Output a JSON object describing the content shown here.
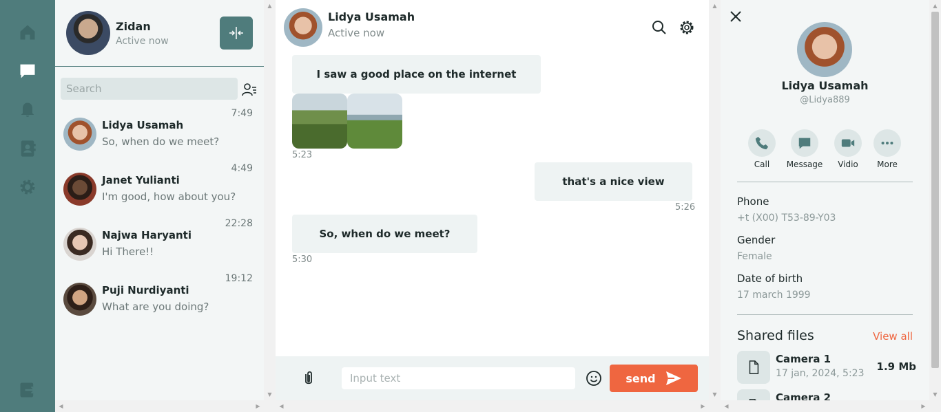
{
  "me": {
    "name": "Zidan",
    "status": "Active now"
  },
  "search": {
    "placeholder": "Search"
  },
  "chats": [
    {
      "name": "Lidya Usamah",
      "message": "So, when do we meet?",
      "time": "7:49"
    },
    {
      "name": "Janet Yulianti",
      "message": "I'm good, how about you?",
      "time": "4:49"
    },
    {
      "name": "Najwa Haryanti",
      "message": "Hi There!!",
      "time": "22:28"
    },
    {
      "name": "Puji Nurdiyanti",
      "message": "What are you doing?",
      "time": "19:12"
    }
  ],
  "conversation": {
    "peer_name": "Lidya Usamah",
    "peer_status": "Active now",
    "messages": [
      {
        "text": "I saw a good place on the internet",
        "time": "5:23",
        "side": "left"
      },
      {
        "text": "that's a nice view",
        "time": "5:26",
        "side": "right"
      },
      {
        "text": "So, when do we meet?",
        "time": "5:30",
        "side": "left"
      }
    ]
  },
  "composer": {
    "placeholder": "Input text",
    "send_label": "send"
  },
  "profile": {
    "name": "Lidya Usamah",
    "handle": "@Lidya889",
    "actions": [
      "Call",
      "Message",
      "Vidio",
      "More"
    ],
    "phone_label": "Phone",
    "phone": "+t (X00) T53-89-Y03",
    "gender_label": "Gender",
    "gender": "Female",
    "dob_label": "Date of birth",
    "dob": "17 march 1999",
    "shared_title": "Shared files",
    "view_all": "View all",
    "files": [
      {
        "name": "Camera 1",
        "meta": "17 jan, 2024, 5:23",
        "size": "1.9 Mb"
      },
      {
        "name": "Camera 2",
        "meta": "",
        "size": ""
      }
    ]
  },
  "colors": {
    "rail": "#4f7c7c",
    "accent": "#ef6640",
    "panel": "#f3f6f6",
    "bubble": "#eef3f3"
  },
  "icons": [
    "home-icon",
    "chat-icon",
    "bell-icon",
    "contacts-icon",
    "gear-icon",
    "logout-icon",
    "collapse-icon",
    "filter-icon",
    "search-icon",
    "settings-icon",
    "paperclip-icon",
    "emoji-icon",
    "send-arrow-icon",
    "close-icon",
    "phone-icon",
    "message-icon",
    "video-icon",
    "more-icon",
    "file-icon"
  ]
}
